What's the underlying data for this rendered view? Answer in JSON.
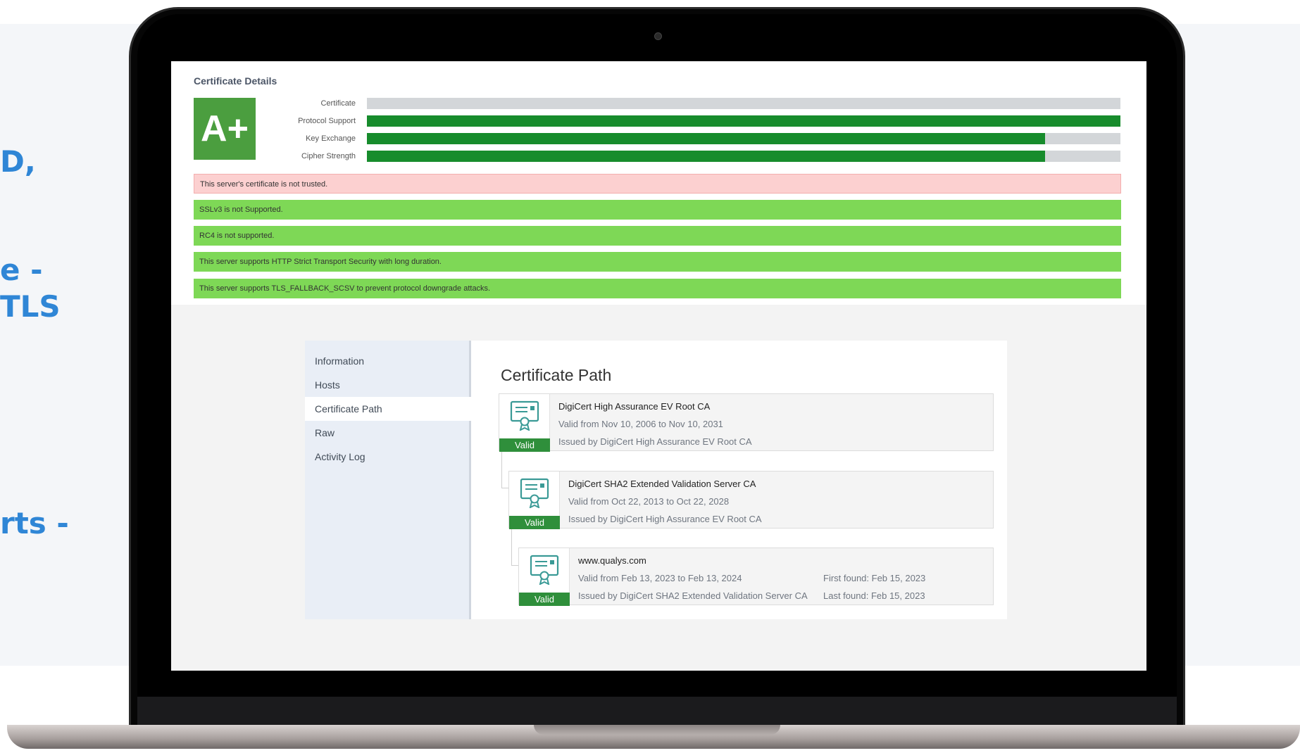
{
  "side_text": [
    "D,",
    "e -",
    "TLS",
    "rts -"
  ],
  "report": {
    "title": "Certificate Details",
    "grade": "A+",
    "bars": [
      {
        "label": "Certificate",
        "value": 0
      },
      {
        "label": "Protocol Support",
        "value": 100
      },
      {
        "label": "Key Exchange",
        "value": 90
      },
      {
        "label": "Cipher Strength",
        "value": 90
      }
    ],
    "messages": [
      {
        "text": "This server's certificate is not trusted.",
        "status": "bad"
      },
      {
        "text": "SSLv3 is not Supported.",
        "status": "good"
      },
      {
        "text": "RC4 is not supported.",
        "status": "good"
      },
      {
        "text": "This server supports HTTP Strict Transport Security with long duration.",
        "status": "good"
      },
      {
        "text": "This server supports TLS_FALLBACK_SCSV to prevent protocol downgrade attacks.",
        "status": "good"
      }
    ]
  },
  "sidebar": {
    "items": [
      {
        "label": "Information",
        "active": false
      },
      {
        "label": "Hosts",
        "active": false
      },
      {
        "label": "Certificate Path",
        "active": true
      },
      {
        "label": "Raw",
        "active": false
      },
      {
        "label": "Activity Log",
        "active": false
      }
    ]
  },
  "path": {
    "title": "Certificate Path",
    "certs": [
      {
        "name": "DigiCert High Assurance EV Root CA",
        "validity": "Valid from Nov 10, 2006 to Nov 10, 2031",
        "issuer": "Issued by DigiCert High Assurance EV Root CA",
        "status": "Valid"
      },
      {
        "name": "DigiCert SHA2 Extended Validation Server CA",
        "validity": "Valid from Oct 22, 2013 to Oct 22, 2028",
        "issuer": "Issued by DigiCert High Assurance EV Root CA",
        "status": "Valid"
      },
      {
        "name": "www.qualys.com",
        "validity": "Valid from Feb 13, 2023 to Feb 13, 2024",
        "issuer": "Issued by DigiCert SHA2 Extended Validation Server CA",
        "first_found": "First found: Feb 15, 2023",
        "last_found": "Last found: Feb 15, 2023",
        "status": "Valid"
      }
    ]
  },
  "colors": {
    "accent_blue": "#2f86d6",
    "grade_green": "#4b9e3f",
    "bar_green": "#178c2c",
    "good_green": "#7ed856",
    "bad_red": "#fcd0d0"
  }
}
